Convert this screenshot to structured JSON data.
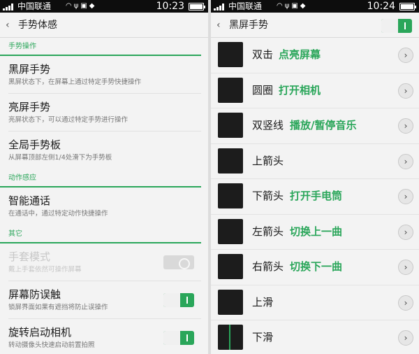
{
  "left": {
    "status": {
      "carrier": "中国联通",
      "time": "10:23"
    },
    "title": "手势体感",
    "sections": [
      {
        "label": "手势操作",
        "rows": [
          {
            "title": "黑屏手势",
            "sub": "黑屏状态下，在屏幕上通过特定手势快捷操作"
          },
          {
            "title": "亮屏手势",
            "sub": "亮屏状态下，可以通过特定手势进行操作"
          },
          {
            "title": "全局手势板",
            "sub": "从屏幕顶部左侧1/4处滑下为手势板"
          }
        ]
      },
      {
        "label": "动作感应",
        "rows": [
          {
            "title": "智能通话",
            "sub": "在通话中，通过特定动作快捷操作"
          }
        ]
      },
      {
        "label": "其它",
        "rows": [
          {
            "title": "手套模式",
            "sub": "戴上手套依然可操作屏幕",
            "toggle": "off",
            "disabled": true
          },
          {
            "title": "屏幕防误触",
            "sub": "锁屏界面如果有遮挡将防止误操作",
            "toggle": "on"
          },
          {
            "title": "旋转启动相机",
            "sub": "转动摄像头快速启动前置拍照",
            "toggle": "on"
          }
        ]
      }
    ]
  },
  "right": {
    "status": {
      "carrier": "中国联通",
      "time": "10:24"
    },
    "title": "黑屏手势",
    "gestures": [
      {
        "label": "双击",
        "action": "点亮屏幕"
      },
      {
        "label": "圆圈",
        "action": "打开相机"
      },
      {
        "label": "双竖线",
        "action": "播放/暂停音乐"
      },
      {
        "label": "上箭头",
        "action": ""
      },
      {
        "label": "下箭头",
        "action": "打开手电筒"
      },
      {
        "label": "左箭头",
        "action": "切换上一曲"
      },
      {
        "label": "右箭头",
        "action": "切换下一曲"
      },
      {
        "label": "上滑",
        "action": ""
      },
      {
        "label": "下滑",
        "action": ""
      }
    ]
  },
  "colors": {
    "accent": "#2aa65a",
    "statusbar": "#0d0d0d",
    "background": "#f3f3f3"
  },
  "icons": [
    "signal-icon",
    "wifi-icon",
    "usb-icon",
    "battery-icon",
    "back-chevron-icon",
    "chevron-right-icon"
  ]
}
